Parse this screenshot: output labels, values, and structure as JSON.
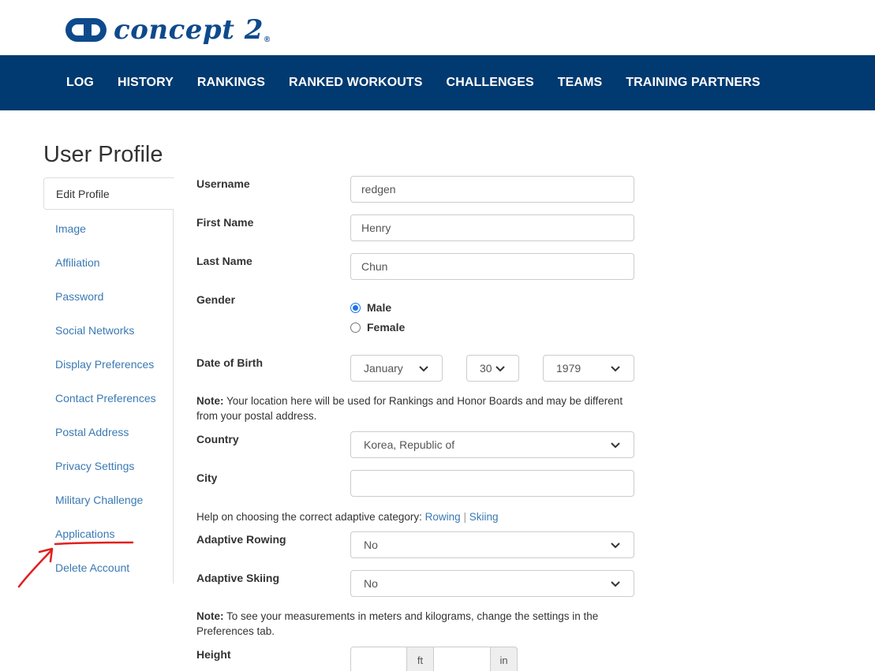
{
  "logo": {
    "text": "concept 2",
    "reg": "®"
  },
  "nav": [
    "LOG",
    "HISTORY",
    "RANKINGS",
    "RANKED WORKOUTS",
    "CHALLENGES",
    "TEAMS",
    "TRAINING PARTNERS"
  ],
  "page_title": "User Profile",
  "sidebar": [
    "Edit Profile",
    "Image",
    "Affiliation",
    "Password",
    "Social Networks",
    "Display Preferences",
    "Contact Preferences",
    "Postal Address",
    "Privacy Settings",
    "Military Challenge",
    "Applications",
    "Delete Account"
  ],
  "form": {
    "username_label": "Username",
    "username_value": "redgen",
    "first_name_label": "First Name",
    "first_name_value": "Henry",
    "last_name_label": "Last Name",
    "last_name_value": "Chun",
    "gender_label": "Gender",
    "gender_male": "Male",
    "gender_female": "Female",
    "dob_label": "Date of Birth",
    "dob_month": "January",
    "dob_day": "30",
    "dob_year": "1979",
    "location_note_bold": "Note:",
    "location_note": " Your location here will be used for Rankings and Honor Boards and may be different from your postal address.",
    "country_label": "Country",
    "country_value": "Korea, Republic of",
    "city_label": "City",
    "city_value": "",
    "adaptive_help": "Help on choosing the correct adaptive category: ",
    "adaptive_rowing_link": "Rowing",
    "adaptive_sep": " | ",
    "adaptive_skiing_link": "Skiing",
    "adaptive_rowing_label": "Adaptive Rowing",
    "adaptive_rowing_value": "No",
    "adaptive_skiing_label": "Adaptive Skiing",
    "adaptive_skiing_value": "No",
    "measure_note_bold": "Note:",
    "measure_note": " To see your measurements in meters and kilograms, change the settings in the Preferences tab.",
    "height_label": "Height",
    "height_ft_unit": "ft",
    "height_in_unit": "in"
  },
  "colors": {
    "nav_bg": "#003a70",
    "link": "#3a79b3",
    "logo": "#0d4a8c",
    "annotation": "#e0201e"
  }
}
